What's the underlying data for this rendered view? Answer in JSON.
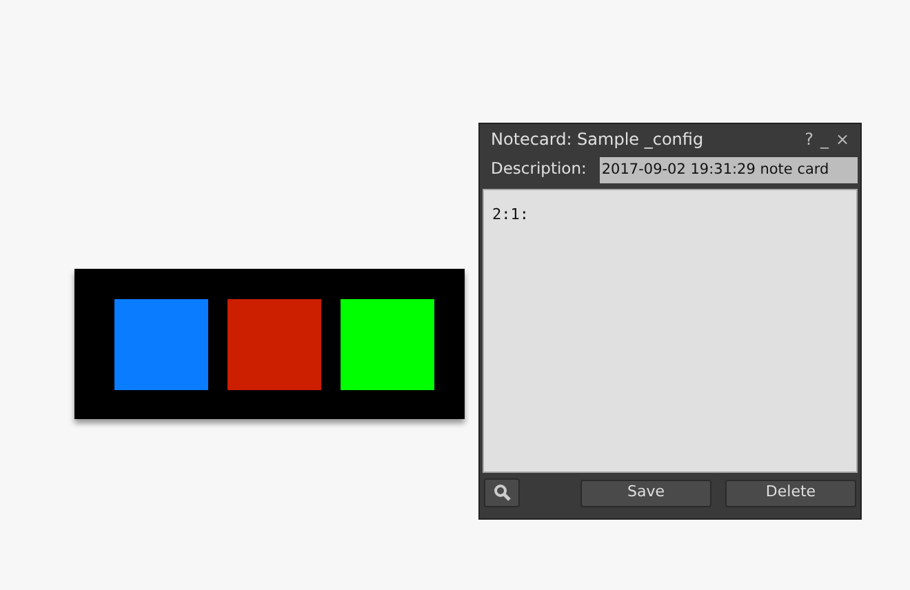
{
  "scene_object": {
    "panels": [
      {
        "color": "#0a7cff"
      },
      {
        "color": "#cc1f00"
      },
      {
        "color": "#00ff00"
      }
    ]
  },
  "window": {
    "title": "Notecard: Sample _config",
    "title_buttons": [
      "?",
      "_",
      "×"
    ],
    "description_label": "Description:",
    "description_value": "2017-09-02 19:31:29 note card",
    "body": "2:1:",
    "buttons": [
      "Save",
      "Delete"
    ]
  }
}
